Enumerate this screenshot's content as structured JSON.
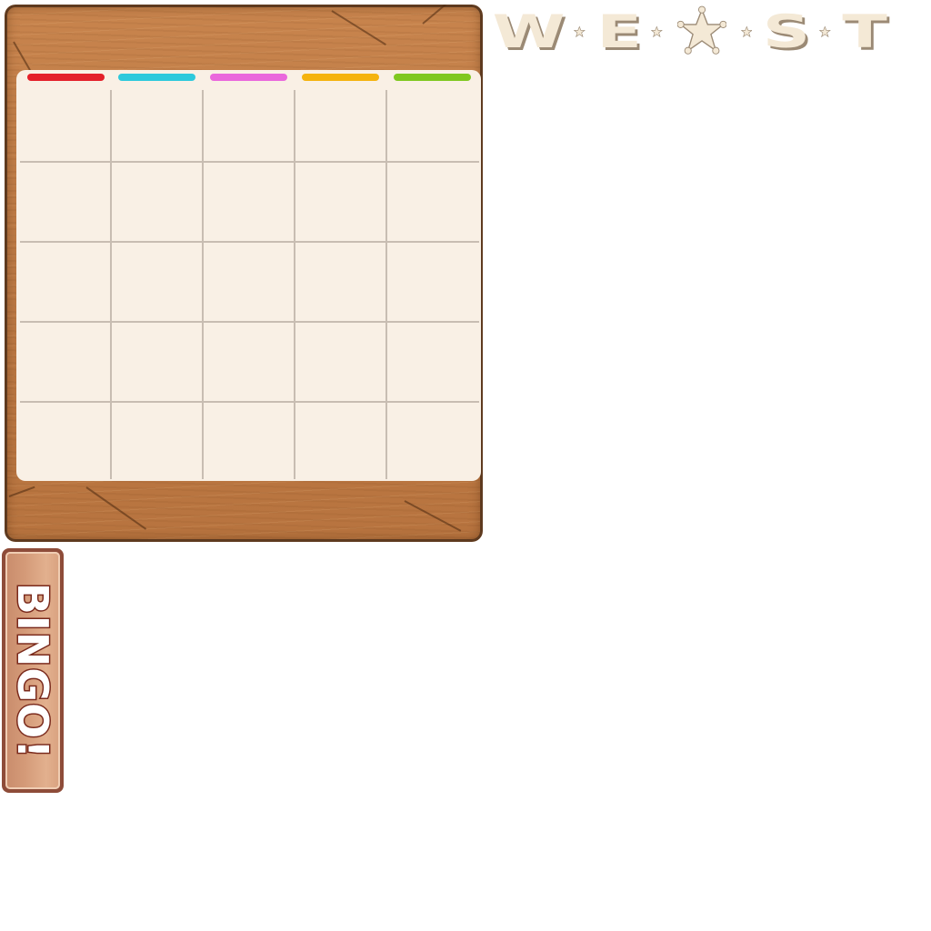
{
  "title": {
    "letters": [
      "W",
      "E",
      "S",
      "T"
    ],
    "letter_color": "#f4e9d6",
    "shadow_color": "#9b8a75",
    "center_icon": "sheriff-star-icon"
  },
  "board": {
    "wood_color": "#bd7a45",
    "edge_color": "#5e3a1f",
    "card_color": "#f9f0e5",
    "grid_color": "#c8bdb2",
    "rows": 5,
    "columns": 5,
    "column_header_colors": [
      "#e4202a",
      "#2ec9dc",
      "#ea68dc",
      "#f5b30e",
      "#80c820"
    ],
    "cells": [
      [
        "",
        "",
        "",
        "",
        ""
      ],
      [
        "",
        "",
        "",
        "",
        ""
      ],
      [
        "",
        "",
        "",
        "",
        ""
      ],
      [
        "",
        "",
        "",
        "",
        ""
      ],
      [
        "",
        "",
        "",
        "",
        ""
      ]
    ]
  },
  "bingo_button": {
    "label": "BINGO!",
    "border_color": "#8e4c39",
    "text_outline_color": "#7a2a1c"
  }
}
